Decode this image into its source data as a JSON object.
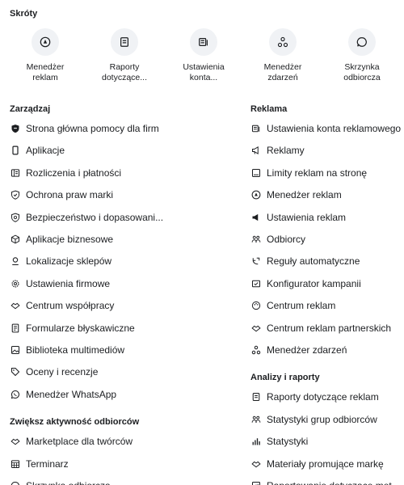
{
  "shortcuts_title": "Skróty",
  "shortcuts": [
    {
      "label": "Menedżer reklam",
      "icon": "ads-manager-icon"
    },
    {
      "label": "Raporty dotyczące...",
      "icon": "reports-icon"
    },
    {
      "label": "Ustawienia konta...",
      "icon": "account-settings-icon"
    },
    {
      "label": "Menedżer zdarzeń",
      "icon": "events-manager-icon"
    },
    {
      "label": "Skrzynka odbiorcza",
      "icon": "inbox-icon"
    }
  ],
  "manage": {
    "title": "Zarządzaj",
    "items": [
      {
        "label": "Strona główna pomocy dla firm",
        "icon": "shield-icon"
      },
      {
        "label": "Aplikacje",
        "icon": "phone-icon"
      },
      {
        "label": "Rozliczenia i płatności",
        "icon": "receipt-icon"
      },
      {
        "label": "Ochrona praw marki",
        "icon": "shield-check-icon"
      },
      {
        "label": "Bezpieczeństwo i dopasowani...",
        "icon": "security-icon"
      },
      {
        "label": "Aplikacje biznesowe",
        "icon": "cube-icon"
      },
      {
        "label": "Lokalizacje sklepów",
        "icon": "store-pin-icon"
      },
      {
        "label": "Ustawienia firmowe",
        "icon": "gear-icon"
      },
      {
        "label": "Centrum współpracy",
        "icon": "handshake-icon"
      },
      {
        "label": "Formularze błyskawiczne",
        "icon": "form-icon"
      },
      {
        "label": "Biblioteka multimediów",
        "icon": "media-icon"
      },
      {
        "label": "Oceny i recenzje",
        "icon": "tag-icon"
      },
      {
        "label": "Menedżer WhatsApp",
        "icon": "whatsapp-icon"
      }
    ]
  },
  "engagement": {
    "title": "Zwiększ aktywność odbiorców",
    "items": [
      {
        "label": "Marketplace dla twórców",
        "icon": "handshake-icon"
      },
      {
        "label": "Terminarz",
        "icon": "calendar-icon"
      },
      {
        "label": "Skrzynka odbiorcza",
        "icon": "inbox-icon"
      }
    ]
  },
  "advertising": {
    "title": "Reklama",
    "items": [
      {
        "label": "Ustawienia konta reklamowego",
        "icon": "account-settings-icon"
      },
      {
        "label": "Reklamy",
        "icon": "megaphone-icon"
      },
      {
        "label": "Limity reklam na stronę",
        "icon": "limit-icon"
      },
      {
        "label": "Menedżer reklam",
        "icon": "ads-manager-icon"
      },
      {
        "label": "Ustawienia reklam",
        "icon": "megaphone-settings-icon"
      },
      {
        "label": "Odbiorcy",
        "icon": "audience-icon"
      },
      {
        "label": "Reguły automatyczne",
        "icon": "rules-icon"
      },
      {
        "label": "Konfigurator kampanii",
        "icon": "campaign-icon"
      },
      {
        "label": "Centrum reklam",
        "icon": "palette-icon"
      },
      {
        "label": "Centrum reklam partnerskich",
        "icon": "handshake-icon"
      },
      {
        "label": "Menedżer zdarzeń",
        "icon": "events-manager-icon"
      }
    ]
  },
  "analytics": {
    "title": "Analizy i raporty",
    "items": [
      {
        "label": "Raporty dotyczące reklam",
        "icon": "reports-icon"
      },
      {
        "label": "Statystyki grup odbiorców",
        "icon": "audience-icon"
      },
      {
        "label": "Statystyki",
        "icon": "bar-chart-icon"
      },
      {
        "label": "Materiały promujące markę",
        "icon": "handshake-icon"
      },
      {
        "label": "Raportowanie dotyczące met...",
        "icon": "report-icon"
      }
    ]
  }
}
